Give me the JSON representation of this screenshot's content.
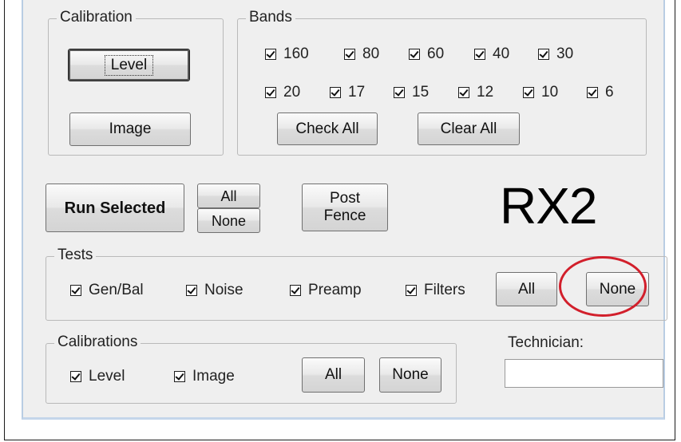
{
  "calibration_group": {
    "title": "Calibration",
    "level_button": "Level",
    "image_button": "Image"
  },
  "bands_group": {
    "title": "Bands",
    "row1": [
      {
        "label": "160",
        "checked": true
      },
      {
        "label": "80",
        "checked": true
      },
      {
        "label": "60",
        "checked": true
      },
      {
        "label": "40",
        "checked": true
      },
      {
        "label": "30",
        "checked": true
      }
    ],
    "row2": [
      {
        "label": "20",
        "checked": true
      },
      {
        "label": "17",
        "checked": true
      },
      {
        "label": "15",
        "checked": true
      },
      {
        "label": "12",
        "checked": true
      },
      {
        "label": "10",
        "checked": true
      },
      {
        "label": "6",
        "checked": true
      }
    ],
    "check_all_button": "Check All",
    "clear_all_button": "Clear All"
  },
  "actions": {
    "run_selected_button": "Run Selected",
    "all_button": "All",
    "none_button": "None",
    "post_fence_line1": "Post",
    "post_fence_line2": "Fence"
  },
  "radio_label": "RX2",
  "tests_group": {
    "title": "Tests",
    "items": [
      {
        "label": "Gen/Bal",
        "checked": true
      },
      {
        "label": "Noise",
        "checked": true
      },
      {
        "label": "Preamp",
        "checked": true
      },
      {
        "label": "Filters",
        "checked": true
      }
    ],
    "all_button": "All",
    "none_button": "None"
  },
  "calibrations_group": {
    "title": "Calibrations",
    "items": [
      {
        "label": "Level",
        "checked": true
      },
      {
        "label": "Image",
        "checked": true
      }
    ],
    "all_button": "All",
    "none_button": "None"
  },
  "technician": {
    "label": "Technician:",
    "value": ""
  },
  "annotation": {
    "highlight_color": "#d21f2b"
  }
}
